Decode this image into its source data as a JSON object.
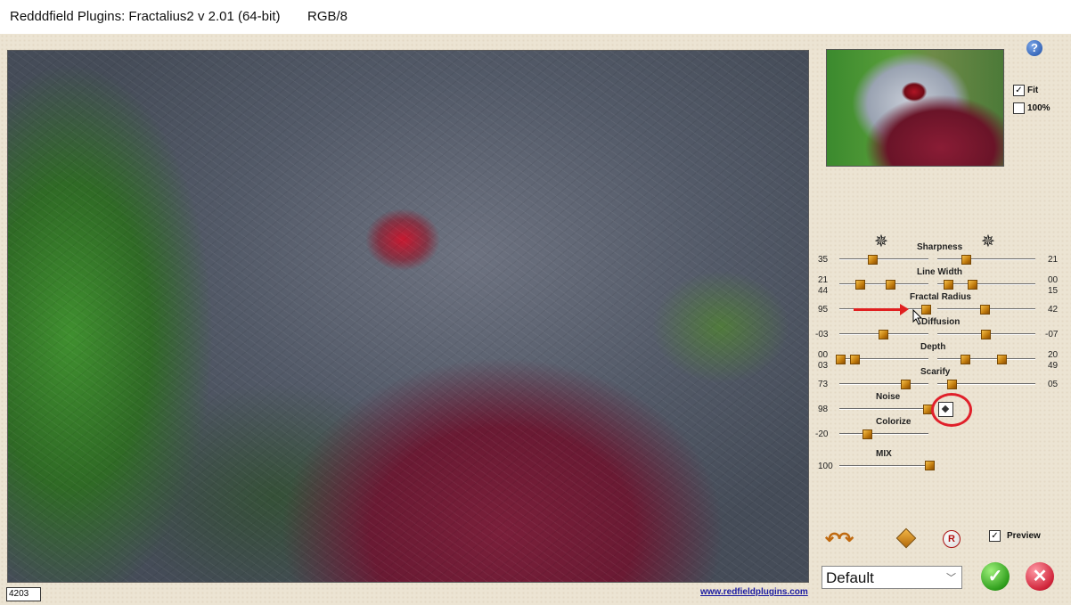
{
  "window": {
    "title": "Redddfield Plugins: Fractalius2 v 2.01 (64-bit)",
    "mode": "RGB/8"
  },
  "status": {
    "coords": "4203",
    "site": "www.redfieldplugins.com"
  },
  "help": {
    "icon": "question-icon",
    "glyph": "?"
  },
  "zoom": {
    "fit_label": "Fit",
    "fit_checked": true,
    "fit_mark": "✓",
    "full_label": "100%",
    "full_checked": false,
    "full_mark": ""
  },
  "sliders": {
    "sharpness": {
      "label": "Sharpness",
      "left": "35",
      "right": "21"
    },
    "line_width": {
      "label": "Line Width",
      "left_top": "21",
      "left_bottom": "44",
      "right_top": "00",
      "right_bottom": "15"
    },
    "fractal_radius": {
      "label": "Fractal Radius",
      "left": "95",
      "right": "42"
    },
    "diffusion": {
      "label": "Diffusion",
      "left": "-03",
      "right": "-07"
    },
    "depth": {
      "label": "Depth",
      "left_top": "00",
      "left_bottom": "03",
      "right_top": "20",
      "right_bottom": "49"
    },
    "scarify": {
      "label": "Scarify",
      "left": "73",
      "right": "05"
    },
    "noise": {
      "label": "Noise",
      "left": "98"
    },
    "colorize": {
      "label": "Colorize",
      "left": "-20"
    },
    "mix": {
      "label": "MIX",
      "left": "100"
    }
  },
  "bottom": {
    "preview_label": "Preview",
    "preview_checked": true,
    "preview_mark": "✓",
    "arrows_glyph": "↶↷",
    "reset_glyph": "R",
    "preset_value": "Default",
    "dropdown_glyph": "﹀",
    "ok_glyph": "✓",
    "cancel_glyph": "✕"
  },
  "colors": {
    "accent_orange": "#c07a0c",
    "ok_green": "#2f9e1c",
    "cancel_red": "#d0243a",
    "annotation_red": "#e02020",
    "link_blue": "#1a1aa0"
  }
}
